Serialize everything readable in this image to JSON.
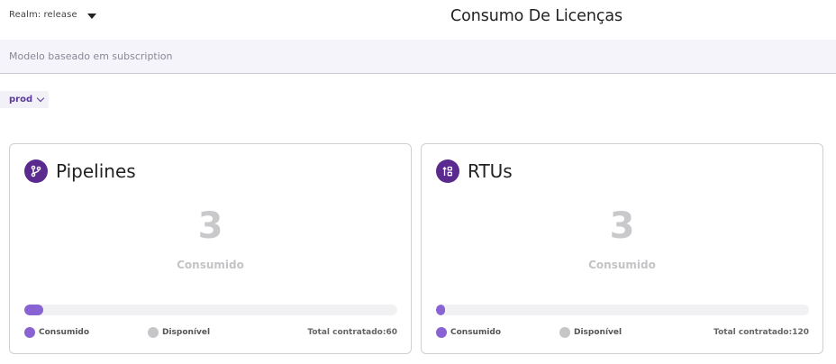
{
  "header": {
    "realm_label": "Realm: release",
    "title": "Consumo De Licenças"
  },
  "subheader": {
    "text": "Modelo baseado em subscription"
  },
  "environment": {
    "selected": "prod"
  },
  "colors": {
    "accent": "#5b2a8f",
    "consumed": "#8a63d2",
    "available": "#c6c6c8"
  },
  "cards": [
    {
      "title": "Pipelines",
      "icon": "git-branch-icon",
      "value": "3",
      "value_label": "Consumido",
      "progress_fraction": 0.05,
      "legend_consumed": "Consumido",
      "legend_available": "Disponível",
      "total": "Total contratado:60"
    },
    {
      "title": "RTUs",
      "icon": "rtu-nodes-icon",
      "value": "3",
      "value_label": "Consumido",
      "progress_fraction": 0.025,
      "legend_consumed": "Consumido",
      "legend_available": "Disponível",
      "total": "Total contratado:120"
    }
  ]
}
